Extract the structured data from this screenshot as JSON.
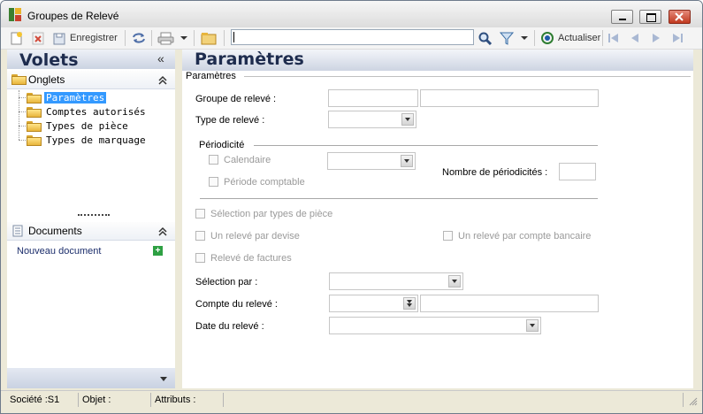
{
  "window": {
    "title": "Groupes de Relevé"
  },
  "toolbar": {
    "save_label": "Enregistrer",
    "search_value": "",
    "refresh_label": "Actualiser"
  },
  "left_panel": {
    "title": "Volets",
    "collapse_glyph": "«",
    "sections": [
      {
        "label": "Onglets",
        "items": [
          "Paramètres",
          "Comptes autorisés",
          "Types de pièce",
          "Types de marquage"
        ],
        "selected": "Paramètres"
      },
      {
        "label": "Documents",
        "items": [
          "Nouveau document"
        ]
      }
    ]
  },
  "main": {
    "title": "Paramètres",
    "group_label": "Paramètres",
    "fields": {
      "groupe_releve": {
        "label": "Groupe de relevé :",
        "code": "",
        "name": ""
      },
      "type_releve": {
        "label": "Type de relevé :",
        "value": ""
      },
      "periodicite": {
        "label": "Périodicité"
      },
      "calendaire": {
        "label": "Calendaire",
        "checked": false,
        "value": ""
      },
      "periode_comptable": {
        "label": "Période comptable",
        "checked": false
      },
      "nb_periodicites": {
        "label": "Nombre de périodicités :",
        "value": ""
      },
      "selection_types_piece": {
        "label": "Sélection par types de pièce",
        "checked": false
      },
      "releve_par_devise": {
        "label": "Un relevé par devise",
        "checked": false
      },
      "releve_par_compte": {
        "label": "Un relevé par compte bancaire",
        "checked": false
      },
      "releve_factures": {
        "label": "Relevé de factures",
        "checked": false
      },
      "selection_par": {
        "label": "Sélection par :",
        "value": ""
      },
      "compte_releve": {
        "label": "Compte du relevé :",
        "code": "",
        "name": ""
      },
      "date_releve": {
        "label": "Date du relevé :",
        "value": ""
      }
    }
  },
  "status": {
    "societe": "Société :S1",
    "objet": "Objet :",
    "attributs": "Attributs :"
  }
}
